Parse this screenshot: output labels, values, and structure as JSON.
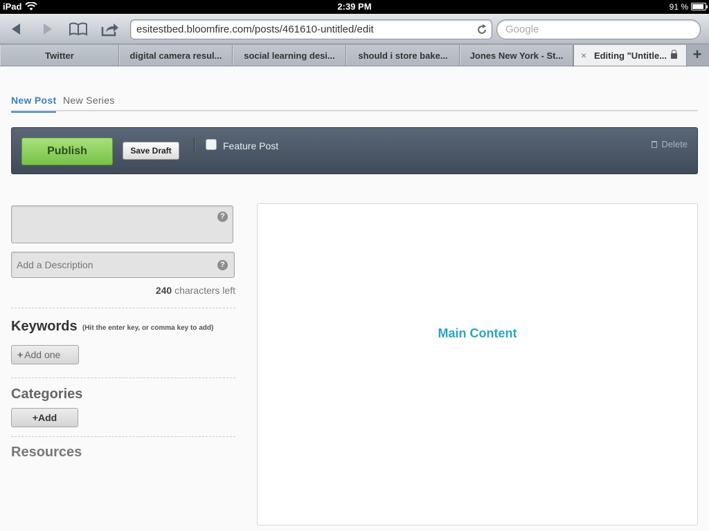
{
  "status_bar": {
    "device": "iPad",
    "time": "2:39 PM",
    "battery_percent": "91 %",
    "battery_level": 0.91
  },
  "browser": {
    "url": "esitestbed.bloomfire.com/posts/461610-untitled/edit",
    "search_placeholder": "Google",
    "tabs": [
      {
        "label": "Twitter",
        "active": false
      },
      {
        "label": "digital camera resul...",
        "active": false
      },
      {
        "label": "social learning desi...",
        "active": false
      },
      {
        "label": "should i store bake...",
        "active": false
      },
      {
        "label": "Jones New York - St...",
        "active": false
      },
      {
        "label": "Editing \"Untitle...",
        "active": true
      }
    ],
    "new_tab_symbol": "+",
    "close_symbol": "×",
    "icons": [
      "back-icon",
      "forward-icon",
      "bookmarks-icon",
      "share-icon",
      "reload-icon",
      "lock-icon"
    ]
  },
  "editor": {
    "post_tabs": [
      "New Post",
      "New Series"
    ],
    "publish_label": "Publish",
    "save_draft_label": "Save Draft",
    "feature_post_label": "Feature Post",
    "feature_post_checked": false,
    "delete_label": "Delete",
    "title_value": "",
    "description_placeholder": "Add a Description",
    "help_symbol": "?",
    "characters_left_count": "240",
    "characters_left_label": "characters left",
    "keywords_heading": "Keywords",
    "keywords_hint": "(Hit the enter key, or comma key to add)",
    "add_keyword_label": "Add one",
    "add_keyword_symbol": "+",
    "categories_heading": "Categories",
    "add_category_label": "+Add",
    "resources_heading": "Resources",
    "main_content_label": "Main Content"
  },
  "colors": {
    "accent_blue": "#3b7fbd",
    "publish_green": "#78c24a",
    "main_content_teal": "#2aa3c4",
    "action_bar": "#4b5768"
  }
}
